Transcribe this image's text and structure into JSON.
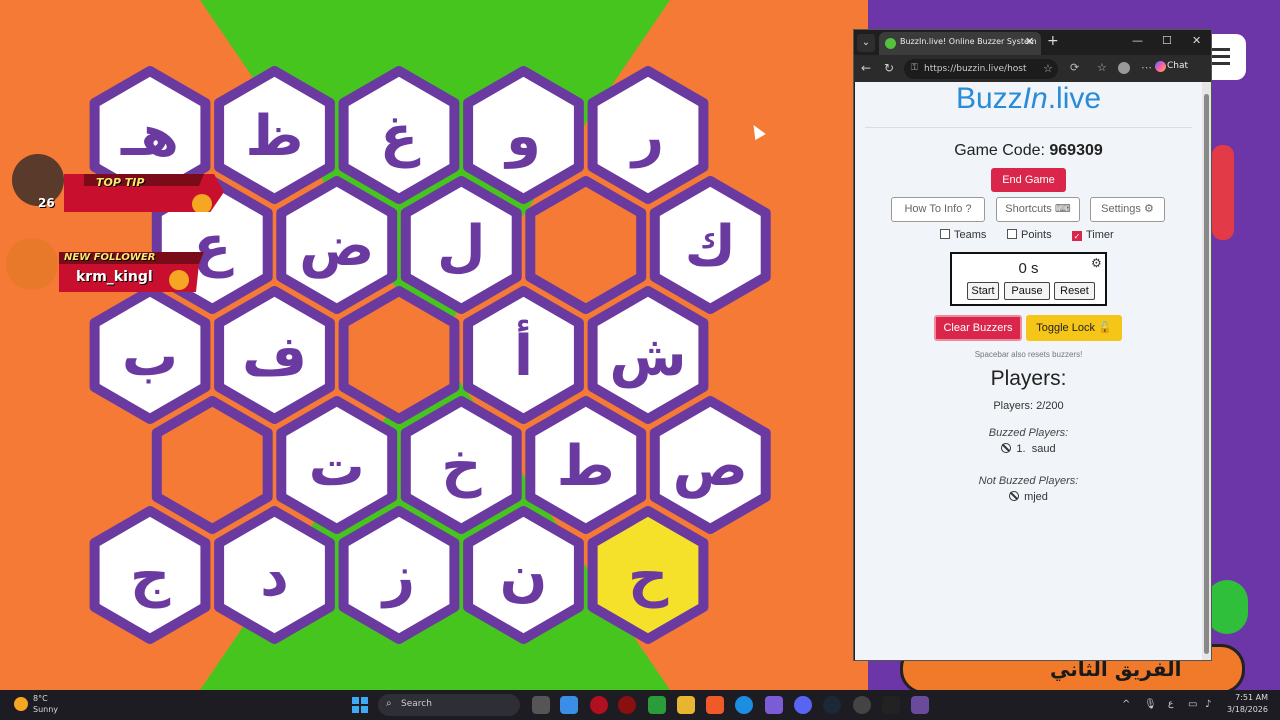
{
  "game": {
    "hexes": [
      {
        "letter": "هـ",
        "color": "white"
      },
      {
        "letter": "ظ",
        "color": "white"
      },
      {
        "letter": "غ",
        "color": "white"
      },
      {
        "letter": "و",
        "color": "white"
      },
      {
        "letter": "ر",
        "color": "white"
      },
      {
        "letter": "ع",
        "color": "white"
      },
      {
        "letter": "ض",
        "color": "white"
      },
      {
        "letter": "ل",
        "color": "white"
      },
      {
        "letter": "",
        "color": "orange"
      },
      {
        "letter": "ك",
        "color": "white"
      },
      {
        "letter": "ب",
        "color": "white"
      },
      {
        "letter": "ف",
        "color": "white"
      },
      {
        "letter": "",
        "color": "orange"
      },
      {
        "letter": "أ",
        "color": "white"
      },
      {
        "letter": "ش",
        "color": "white"
      },
      {
        "letter": "",
        "color": "orange"
      },
      {
        "letter": "ت",
        "color": "white"
      },
      {
        "letter": "خ",
        "color": "white"
      },
      {
        "letter": "ط",
        "color": "white"
      },
      {
        "letter": "ص",
        "color": "white"
      },
      {
        "letter": "ج",
        "color": "white"
      },
      {
        "letter": "د",
        "color": "white"
      },
      {
        "letter": "ز",
        "color": "white"
      },
      {
        "letter": "ن",
        "color": "white"
      },
      {
        "letter": "ح",
        "color": "yellow"
      }
    ],
    "colors": {
      "purple": "#6b3aa0",
      "orange": "#f47a36",
      "green": "#46c51e",
      "yellow": "#f5e12a",
      "white": "#ffffff"
    },
    "team_name": "الفريق الثاني"
  },
  "overlay": {
    "top_tip_label": "TOP TIP",
    "top_tip_amount": "26",
    "follower_label": "NEW FOLLOWER",
    "follower_name": "krm_kingl"
  },
  "browser": {
    "tab_title": "BuzzIn.live! Online Buzzer System",
    "url": "https://buzzin.live/host",
    "chat_label": "Chat"
  },
  "page": {
    "logo_buzz": "Buzz",
    "logo_in": "In",
    "logo_live": ".live",
    "game_code_label": "Game Code: ",
    "game_code": "969309",
    "end_game": "End Game",
    "how_to": "How To Info",
    "shortcuts": "Shortcuts",
    "settings": "Settings",
    "teams": "Teams",
    "points": "Points",
    "timer": "Timer",
    "timer_value": "0 s",
    "start": "Start",
    "pause": "Pause",
    "reset": "Reset",
    "clear_buzzers": "Clear Buzzers",
    "toggle_lock": "Toggle Lock",
    "hint": "Spacebar also resets buzzers!",
    "players_heading": "Players:",
    "players_count": "Players: 2/200",
    "buzzed_heading": "Buzzed Players:",
    "buzzed": [
      {
        "rank": "1.",
        "name": "saud"
      }
    ],
    "not_buzzed_heading": "Not Buzzed Players:",
    "not_buzzed": [
      {
        "name": "mjed"
      }
    ]
  },
  "taskbar": {
    "weather_temp": "8°C",
    "weather_desc": "Sunny",
    "search_placeholder": "Search",
    "time": "7:51 AM",
    "date": "3/18/2026",
    "lang": "ع"
  }
}
